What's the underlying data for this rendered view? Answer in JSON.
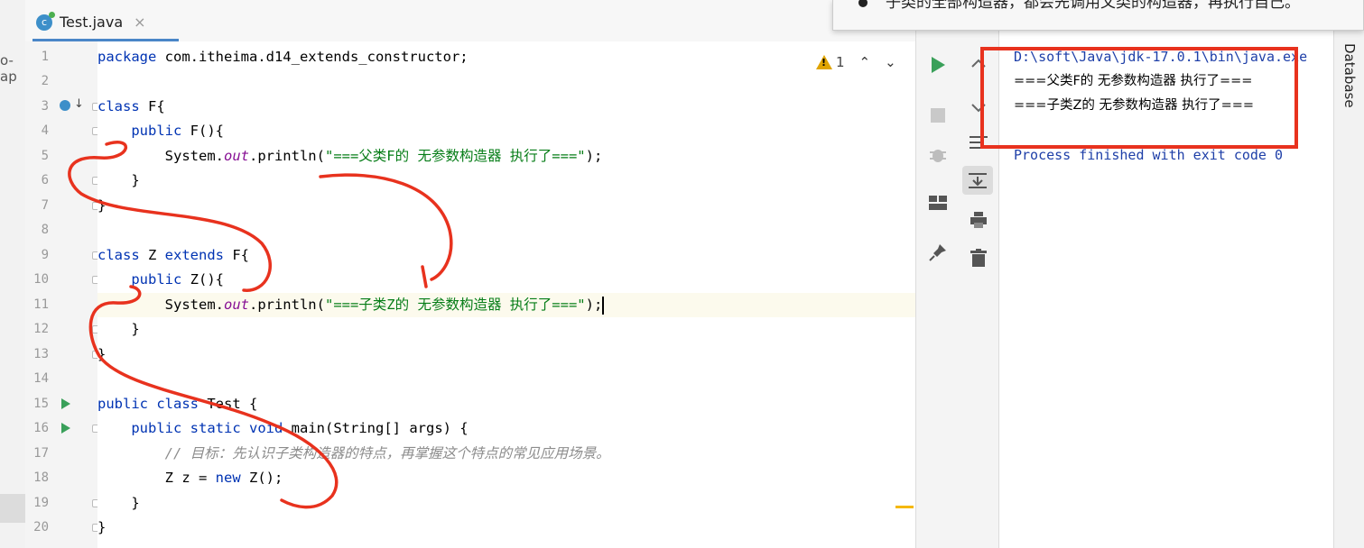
{
  "left_panel": {
    "crumb": "o-ap"
  },
  "editor_tab": {
    "name": "Test.java",
    "icon_letter": "c",
    "close": "×"
  },
  "inspection": {
    "count": "1",
    "prev": "⌃",
    "next": "⌄"
  },
  "tooltip": {
    "text": "子类的全部构造器，都会先调用父类的构造器，再执行自己。"
  },
  "code_lines": [
    {
      "n": "1"
    },
    {
      "n": "2"
    },
    {
      "n": "3"
    },
    {
      "n": "4"
    },
    {
      "n": "5"
    },
    {
      "n": "6"
    },
    {
      "n": "7"
    },
    {
      "n": "8"
    },
    {
      "n": "9"
    },
    {
      "n": "10"
    },
    {
      "n": "11"
    },
    {
      "n": "12"
    },
    {
      "n": "13"
    },
    {
      "n": "14"
    },
    {
      "n": "15"
    },
    {
      "n": "16"
    },
    {
      "n": "17"
    },
    {
      "n": "18"
    },
    {
      "n": "19"
    },
    {
      "n": "20"
    }
  ],
  "code": {
    "l1_kw": "package",
    "l1_rest": " com.itheima.d14_extends_constructor;",
    "l3_kw": "class",
    "l3_rest": " F{",
    "l4_kw": "public",
    "l4_rest": " F(){",
    "l5_a": "System.",
    "l5_out": "out",
    "l5_b": ".println(",
    "l5_str": "\"===父类F的 无参数构造器 执行了===\"",
    "l5_c": ");",
    "l6": "}",
    "l7": "}",
    "l9_kw1": "class",
    "l9_mid": " Z ",
    "l9_kw2": "extends",
    "l9_rest": " F{",
    "l10_kw": "public",
    "l10_rest": " Z(){",
    "l11_a": "System.",
    "l11_out": "out",
    "l11_b": ".println(",
    "l11_str": "\"===子类Z的 无参数构造器 执行了===\"",
    "l11_c": ");",
    "l12": "}",
    "l13": "}",
    "l15_kw1": "public",
    "l15_kw2": "class",
    "l15_rest": " Test {",
    "l16_kw1": "public",
    "l16_kw2": "static",
    "l16_kw3": "void",
    "l16_rest": " main(String[] args) {",
    "l17_cmt": "// 目标：先认识子类构造器的特点，再掌握这个特点的常见应用场景。",
    "l18_a": "Z ",
    "l18_var": "z",
    "l18_b": " = ",
    "l18_kw": "new",
    "l18_c": " Z();",
    "l19": "}",
    "l20": "}"
  },
  "console": {
    "cmd": "D:\\soft\\Java\\jdk-17.0.1\\bin\\java.exe",
    "out1": "===父类F的 无参数构造器 执行了===",
    "out2": "===子类Z的 无参数构造器 执行了===",
    "done": "Process finished with exit code 0"
  },
  "right_tool": {
    "database": "Database"
  },
  "colors": {
    "keyword": "#0033b3",
    "string": "#067d17",
    "annotation": "#e8321e",
    "run": "#3aa05a"
  }
}
